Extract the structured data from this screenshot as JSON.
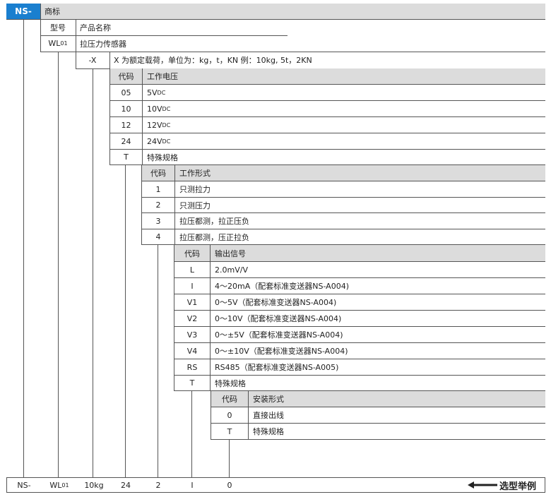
{
  "top": {
    "prefix": "NS-",
    "trademark": "商标",
    "model_label": "型号",
    "product_name": "产品名称",
    "model_code": "WL",
    "model_sub": "01",
    "product_value": "拉压力传感器"
  },
  "load": {
    "code": "-X",
    "desc": "X 为额定载荷，单位为：kg，t，KN 例：10kg, 5t，2KN"
  },
  "voltage": {
    "header_code": "代码",
    "header_label": "工作电压",
    "rows": [
      {
        "code": "05",
        "value": "5V",
        "unit": "DC"
      },
      {
        "code": "10",
        "value": "10V",
        "unit": "DC"
      },
      {
        "code": "12",
        "value": "12V",
        "unit": "DC"
      },
      {
        "code": "24",
        "value": "24V",
        "unit": "DC"
      },
      {
        "code": "T",
        "value": "特殊规格",
        "unit": ""
      }
    ]
  },
  "work_form": {
    "header_code": "代码",
    "header_label": "工作形式",
    "rows": [
      {
        "code": "1",
        "value": "只测拉力"
      },
      {
        "code": "2",
        "value": "只测压力"
      },
      {
        "code": "3",
        "value": "拉压都测，拉正压负"
      },
      {
        "code": "4",
        "value": "拉压都测，压正拉负"
      }
    ]
  },
  "output": {
    "header_code": "代码",
    "header_label": "输出信号",
    "rows": [
      {
        "code": "L",
        "value": "2.0mV/V"
      },
      {
        "code": "I",
        "value": "4～20mA（配套标准变送器NS-A004)"
      },
      {
        "code": "V1",
        "value": "0～5V（配套标准变送器NS-A004)"
      },
      {
        "code": "V2",
        "value": "0～10V（配套标准变送器NS-A004)"
      },
      {
        "code": "V3",
        "value": "0～±5V（配套标准变送器NS-A004)"
      },
      {
        "code": "V4",
        "value": "0～±10V（配套标准变送器NS-A004)"
      },
      {
        "code": "RS",
        "value": "RS485（配套标准变送器NS-A005)"
      },
      {
        "code": "T",
        "value": "特殊规格"
      }
    ]
  },
  "install": {
    "header_code": "代码",
    "header_label": "安装形式",
    "rows": [
      {
        "code": "0",
        "value": "直接出线"
      },
      {
        "code": "T",
        "value": "特殊规格"
      }
    ]
  },
  "example": {
    "values": [
      "NS-",
      "WL",
      "10kg",
      "24",
      "2",
      "I",
      "0"
    ],
    "model_sub": "01",
    "label": "选型举例"
  },
  "colors": {
    "accent": "#1a7fcf",
    "header_bg": "#dcdcdc",
    "line": "#555555"
  }
}
